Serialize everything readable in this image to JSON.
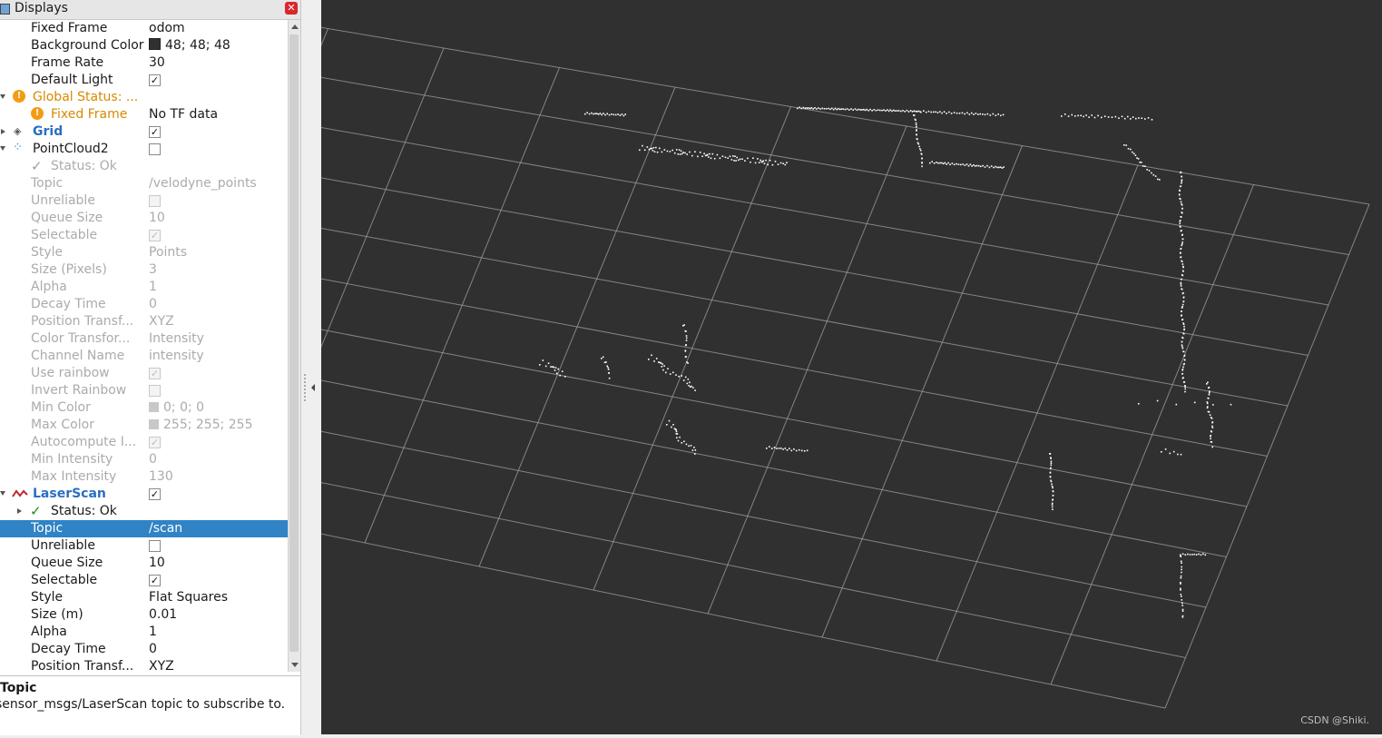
{
  "panel": {
    "title": "Displays",
    "close_icon": "close-icon"
  },
  "rows": {
    "fixed_frame": {
      "label": "Fixed Frame",
      "value": "odom"
    },
    "background_color": {
      "label": "Background Color",
      "value": "48; 48; 48",
      "color": "#303030"
    },
    "frame_rate": {
      "label": "Frame Rate",
      "value": "30"
    },
    "default_light": {
      "label": "Default Light",
      "checked": "✓"
    },
    "global_status": {
      "label": "Global Status: ..."
    },
    "global_fixed_frame": {
      "label": "Fixed Frame",
      "value": "No TF data"
    },
    "grid": {
      "label": "Grid",
      "checked": "✓"
    },
    "pointcloud2": {
      "label": "PointCloud2",
      "checked": ""
    },
    "pc_status": {
      "label": "Status: Ok"
    },
    "pc_topic": {
      "label": "Topic",
      "value": "/velodyne_points"
    },
    "pc_unreliable": {
      "label": "Unreliable",
      "checked": ""
    },
    "pc_queue": {
      "label": "Queue Size",
      "value": "10"
    },
    "pc_selectable": {
      "label": "Selectable",
      "checked": "✓"
    },
    "pc_style": {
      "label": "Style",
      "value": "Points"
    },
    "pc_size": {
      "label": "Size (Pixels)",
      "value": "3"
    },
    "pc_alpha": {
      "label": "Alpha",
      "value": "1"
    },
    "pc_decay": {
      "label": "Decay Time",
      "value": "0"
    },
    "pc_position": {
      "label": "Position Transf...",
      "value": "XYZ"
    },
    "pc_color": {
      "label": "Color Transfor...",
      "value": "Intensity"
    },
    "pc_channel": {
      "label": "Channel Name",
      "value": "intensity"
    },
    "pc_rainbow": {
      "label": "Use rainbow",
      "checked": "✓"
    },
    "pc_invert": {
      "label": "Invert Rainbow",
      "checked": ""
    },
    "pc_mincolor": {
      "label": "Min Color",
      "value": "0; 0; 0",
      "color": "#c8c8c8"
    },
    "pc_maxcolor": {
      "label": "Max Color",
      "value": "255; 255; 255",
      "color": "#c8c8c8"
    },
    "pc_autocompute": {
      "label": "Autocompute I...",
      "checked": "✓"
    },
    "pc_minint": {
      "label": "Min Intensity",
      "value": "0"
    },
    "pc_maxint": {
      "label": "Max Intensity",
      "value": "130"
    },
    "laserscan": {
      "label": "LaserScan",
      "checked": "✓"
    },
    "ls_status": {
      "label": "Status: Ok"
    },
    "ls_topic": {
      "label": "Topic",
      "value": "/scan"
    },
    "ls_unreliable": {
      "label": "Unreliable",
      "checked": ""
    },
    "ls_queue": {
      "label": "Queue Size",
      "value": "10"
    },
    "ls_selectable": {
      "label": "Selectable",
      "checked": "✓"
    },
    "ls_style": {
      "label": "Style",
      "value": "Flat Squares"
    },
    "ls_size": {
      "label": "Size (m)",
      "value": "0.01"
    },
    "ls_alpha": {
      "label": "Alpha",
      "value": "1"
    },
    "ls_decay": {
      "label": "Decay Time",
      "value": "0"
    },
    "ls_position": {
      "label": "Position Transf...",
      "value": "XYZ"
    }
  },
  "description": {
    "heading": "Topic",
    "text": "sensor_msgs/LaserScan topic to subscribe to."
  },
  "viewport": {
    "background": "#303030",
    "grid_color": "#a0a0a0",
    "point_color": "#ffffff",
    "watermark": "CSDN @Shiki."
  }
}
